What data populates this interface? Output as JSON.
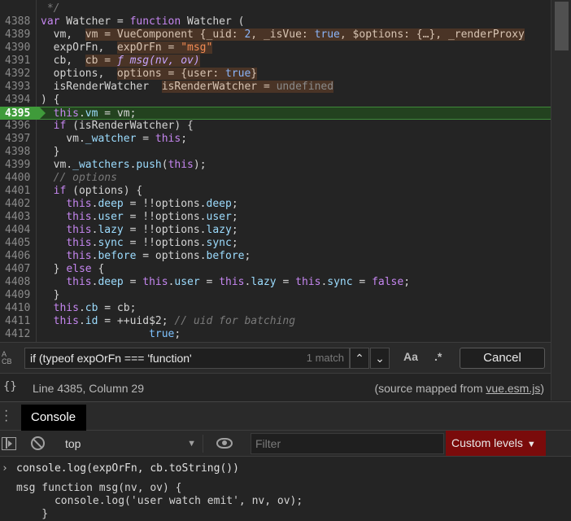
{
  "editor": {
    "lines": [
      {
        "n": "",
        "html": "<span class=\"cm\"> */</span>"
      },
      {
        "n": "4388",
        "html": "<span class=\"kw\">var</span> Watcher = <span class=\"kw\">function</span> Watcher ("
      },
      {
        "n": "4389",
        "html": "  vm,  <span class=\"inl\">vm = VueComponent {_uid: <span class=\"v-blue\">2</span>, _isVue: <span class=\"v-blue\">true</span>, $options: {…}, _renderProxy</span>"
      },
      {
        "n": "4390",
        "html": "  expOrFn,  <span class=\"inl\">expOrFn = <span class=\"v-str\">\"msg\"</span></span>"
      },
      {
        "n": "4391",
        "html": "  cb,  <span class=\"inl\">cb = <span class=\"v-fn\">ƒ msg(nv, ov)</span></span>"
      },
      {
        "n": "4392",
        "html": "  options,  <span class=\"inl\">options = {user: <span class=\"v-blue\">true</span>}</span>"
      },
      {
        "n": "4393",
        "html": "  isRenderWatcher  <span class=\"inl\">isRenderWatcher = <span class=\"v-undef\">undefined</span></span>"
      },
      {
        "n": "4394",
        "html": ") {"
      },
      {
        "n": "4395",
        "html": "  <span class=\"kw\">this</span>.<span class=\"prop\">vm</span> = vm;",
        "exec": true
      },
      {
        "n": "4396",
        "html": "  <span class=\"kw\">if</span> (isRenderWatcher) {"
      },
      {
        "n": "4397",
        "html": "    vm.<span class=\"prop\">_watcher</span> = <span class=\"kw\">this</span>;"
      },
      {
        "n": "4398",
        "html": "  }"
      },
      {
        "n": "4399",
        "html": "  vm.<span class=\"prop\">_watchers</span>.<span class=\"prop\">push</span>(<span class=\"kw\">this</span>);"
      },
      {
        "n": "4400",
        "html": "  <span class=\"cm\">// options</span>"
      },
      {
        "n": "4401",
        "html": "  <span class=\"kw\">if</span> (options) {"
      },
      {
        "n": "4402",
        "html": "    <span class=\"kw\">this</span>.<span class=\"prop\">deep</span> = !!options.<span class=\"prop\">deep</span>;"
      },
      {
        "n": "4403",
        "html": "    <span class=\"kw\">this</span>.<span class=\"prop\">user</span> = !!options.<span class=\"prop\">user</span>;"
      },
      {
        "n": "4404",
        "html": "    <span class=\"kw\">this</span>.<span class=\"prop\">lazy</span> = !!options.<span class=\"prop\">lazy</span>;"
      },
      {
        "n": "4405",
        "html": "    <span class=\"kw\">this</span>.<span class=\"prop\">sync</span> = !!options.<span class=\"prop\">sync</span>;"
      },
      {
        "n": "4406",
        "html": "    <span class=\"kw\">this</span>.<span class=\"prop\">before</span> = options.<span class=\"prop\">before</span>;"
      },
      {
        "n": "4407",
        "html": "  } <span class=\"kw\">else</span> {"
      },
      {
        "n": "4408",
        "html": "    <span class=\"kw\">this</span>.<span class=\"prop\">deep</span> = <span class=\"kw\">this</span>.<span class=\"prop\">user</span> = <span class=\"kw\">this</span>.<span class=\"prop\">lazy</span> = <span class=\"kw\">this</span>.<span class=\"prop\">sync</span> = <span class=\"kw\">false</span>;"
      },
      {
        "n": "4409",
        "html": "  }"
      },
      {
        "n": "4410",
        "html": "  <span class=\"kw\">this</span>.<span class=\"prop\">cb</span> = cb;"
      },
      {
        "n": "4411",
        "html": "  <span class=\"kw\">this</span>.<span class=\"prop\">id</span> = ++uid$2; <span class=\"cm\">// uid for batching</span>"
      },
      {
        "n": "4412",
        "html": "                 <span class=\"tr\">true</span>;"
      }
    ]
  },
  "search": {
    "replace_toggle_label": "A\nCB",
    "query": "if (typeof expOrFn === 'function'",
    "match_count": "1 match",
    "prev_label": "⌃",
    "next_label": "⌄",
    "match_case_label": "Aa",
    "regex_label": ".*",
    "cancel_label": "Cancel"
  },
  "status": {
    "braces_label": "{}",
    "cursor": "Line 4385, Column 29",
    "source_prefix": "(source mapped from ",
    "source_file": "vue.esm.js",
    "source_suffix": ")"
  },
  "console": {
    "tab_label": "Console",
    "context": "top",
    "filter_placeholder": "Filter",
    "levels_label": "Custom levels",
    "input": "console.log(expOrFn, cb.toString())",
    "output": [
      "msg function msg(nv, ov) {",
      "      console.log('user watch emit', nv, ov);",
      "    }"
    ]
  },
  "colors": {
    "exec_line": "#3f9b3a",
    "levels_bg": "#7a0b0b",
    "keyword": "#c586f0"
  }
}
